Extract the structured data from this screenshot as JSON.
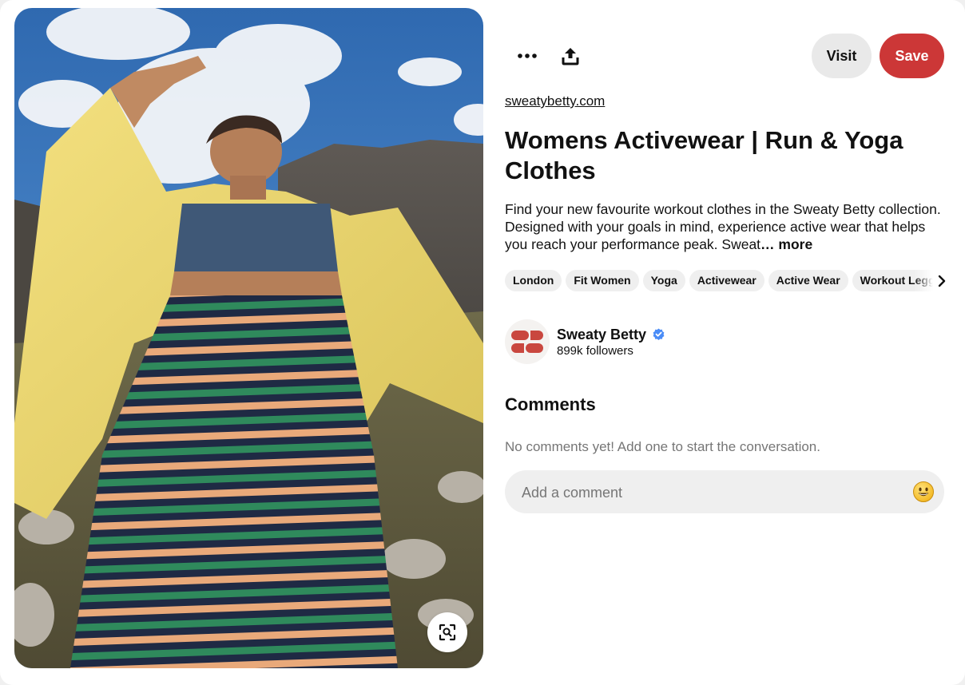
{
  "pin": {
    "image_alt": "Woman in yellow jacket and striped knit skirt posing against mountains and blue sky",
    "visual_search_icon": "visual-search-icon"
  },
  "toolbar": {
    "more_icon": "ellipsis-icon",
    "share_icon": "share-upload-icon",
    "visit_label": "Visit",
    "save_label": "Save"
  },
  "colors": {
    "save_red": "#cc3737",
    "pill_gray": "#e9e9e9",
    "muted_text": "#767676",
    "verified_blue": "#4a8cf7",
    "avatar_brand": "#c9473f"
  },
  "source": {
    "domain": "sweatybetty.com"
  },
  "title": "Womens Activewear | Run & Yoga Clothes",
  "description": {
    "text": "Find your new favourite workout clothes in the Sweaty Betty collection. Designed with your goals in mind, experience active wear that helps you reach your performance peak. Sweat",
    "more_label": "… more"
  },
  "tags": [
    "London",
    "Fit Women",
    "Yoga",
    "Activewear",
    "Active Wear",
    "Workout Leggings"
  ],
  "creator": {
    "name": "Sweaty Betty",
    "verified_icon": "verified-badge-icon",
    "followers": "899k followers"
  },
  "comments": {
    "heading": "Comments",
    "empty_text": "No comments yet! Add one to start the conversation.",
    "input_placeholder": "Add a comment",
    "emoji_icon": "smiley-emoji-icon"
  }
}
